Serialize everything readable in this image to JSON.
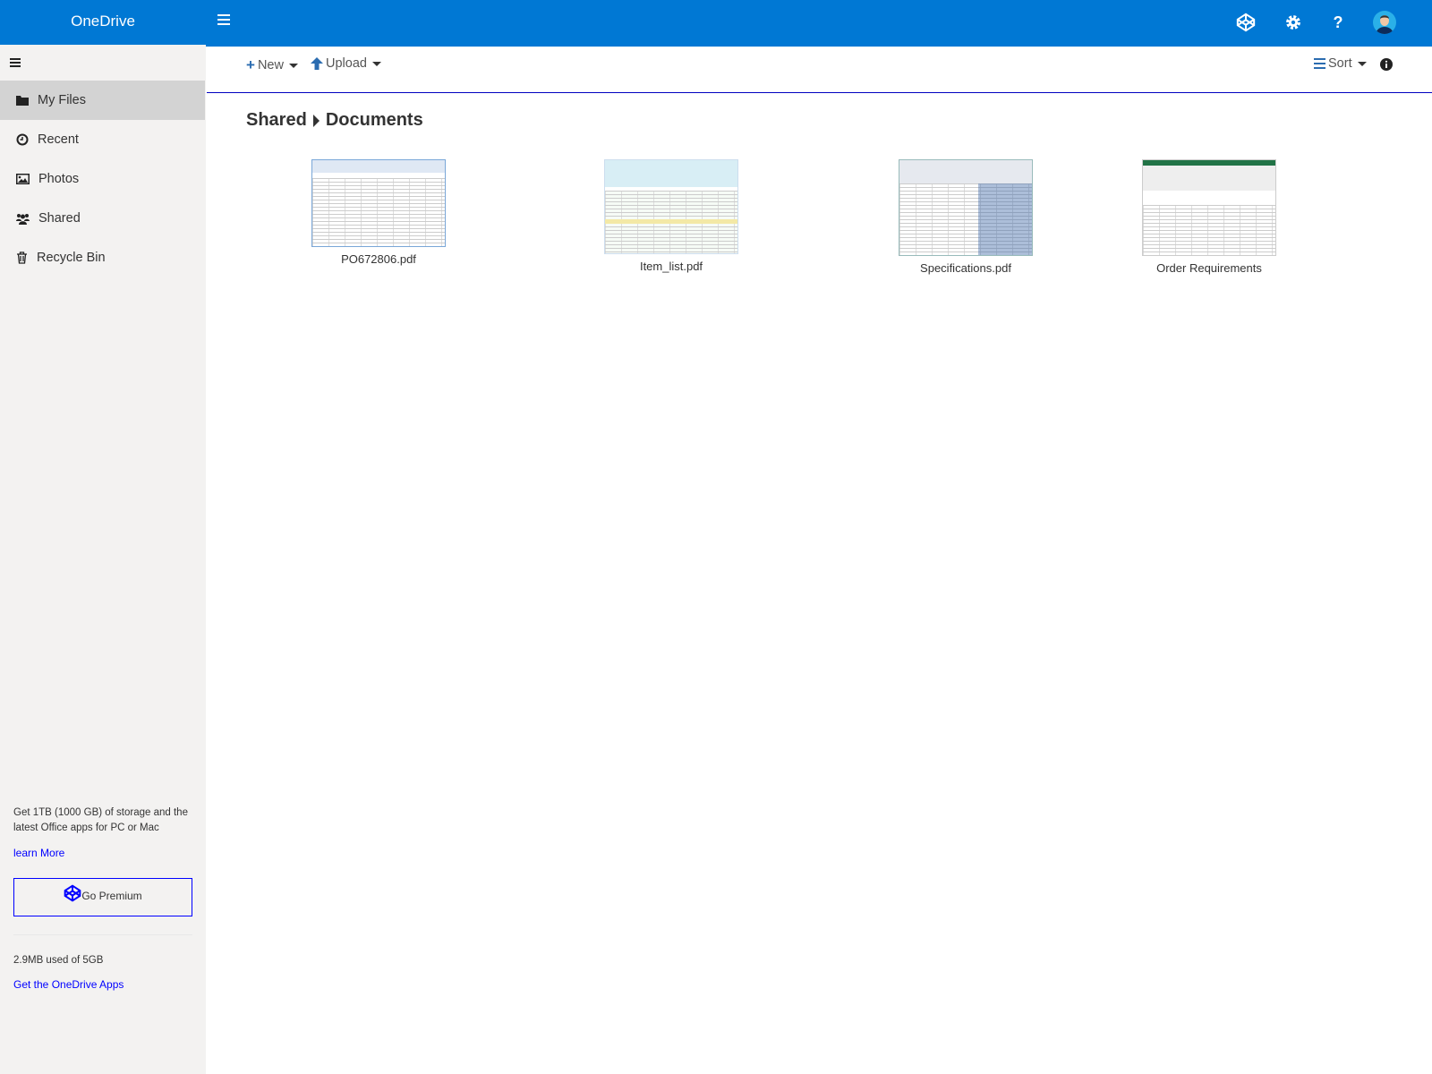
{
  "header": {
    "brand": "OneDrive",
    "icons": [
      "codepen-icon",
      "gear-icon",
      "help-icon",
      "avatar"
    ]
  },
  "sidebar": {
    "items": [
      {
        "label": "My Files",
        "icon": "folder-icon",
        "active": true
      },
      {
        "label": "Recent",
        "icon": "clock-icon"
      },
      {
        "label": "Photos",
        "icon": "image-icon"
      },
      {
        "label": "Shared",
        "icon": "users-icon"
      },
      {
        "label": "Recycle Bin",
        "icon": "trash-icon"
      }
    ],
    "promo": "Get 1TB (1000 GB) of storage and the latest Office apps for PC or Mac",
    "learn_more": "learn More",
    "premium": "Go Premium",
    "usage": "2.9MB used of 5GB",
    "apps_link": "Get the OneDrive Apps"
  },
  "toolbar": {
    "new": "New",
    "upload": "Upload",
    "sort": "Sort"
  },
  "breadcrumb": [
    "Shared",
    "Documents"
  ],
  "files": [
    {
      "name": "PO672806.pdf"
    },
    {
      "name": "Item_list.pdf"
    },
    {
      "name": "Specifications.pdf"
    },
    {
      "name": "Order Requirements"
    }
  ],
  "colors": {
    "brand": "#0078d4",
    "link": "#0000ff"
  }
}
